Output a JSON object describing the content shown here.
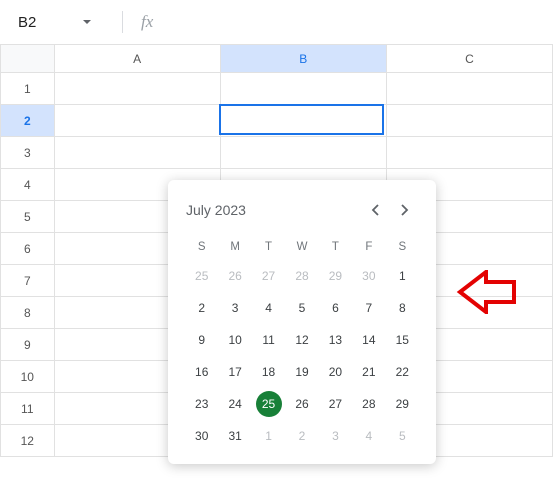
{
  "nameBox": {
    "cellRef": "B2"
  },
  "formulaBar": {
    "fxGlyph": "fx",
    "value": ""
  },
  "columns": [
    "A",
    "B",
    "C"
  ],
  "rows": [
    "1",
    "2",
    "3",
    "4",
    "5",
    "6",
    "7",
    "8",
    "9",
    "10",
    "11",
    "12"
  ],
  "selected": {
    "col": "B",
    "row": "2"
  },
  "datePicker": {
    "title": "July 2023",
    "dow": [
      "S",
      "M",
      "T",
      "W",
      "T",
      "F",
      "S"
    ],
    "weeks": [
      [
        {
          "d": "25",
          "dim": true
        },
        {
          "d": "26",
          "dim": true
        },
        {
          "d": "27",
          "dim": true
        },
        {
          "d": "28",
          "dim": true
        },
        {
          "d": "29",
          "dim": true
        },
        {
          "d": "30",
          "dim": true
        },
        {
          "d": "1"
        }
      ],
      [
        {
          "d": "2"
        },
        {
          "d": "3"
        },
        {
          "d": "4"
        },
        {
          "d": "5"
        },
        {
          "d": "6"
        },
        {
          "d": "7"
        },
        {
          "d": "8"
        }
      ],
      [
        {
          "d": "9"
        },
        {
          "d": "10"
        },
        {
          "d": "11"
        },
        {
          "d": "12"
        },
        {
          "d": "13"
        },
        {
          "d": "14"
        },
        {
          "d": "15"
        }
      ],
      [
        {
          "d": "16"
        },
        {
          "d": "17"
        },
        {
          "d": "18"
        },
        {
          "d": "19"
        },
        {
          "d": "20"
        },
        {
          "d": "21"
        },
        {
          "d": "22"
        }
      ],
      [
        {
          "d": "23"
        },
        {
          "d": "24"
        },
        {
          "d": "25",
          "today": true
        },
        {
          "d": "26"
        },
        {
          "d": "27"
        },
        {
          "d": "28"
        },
        {
          "d": "29"
        }
      ],
      [
        {
          "d": "30"
        },
        {
          "d": "31"
        },
        {
          "d": "1",
          "dim": true
        },
        {
          "d": "2",
          "dim": true
        },
        {
          "d": "3",
          "dim": true
        },
        {
          "d": "4",
          "dim": true
        },
        {
          "d": "5",
          "dim": true
        }
      ]
    ]
  }
}
